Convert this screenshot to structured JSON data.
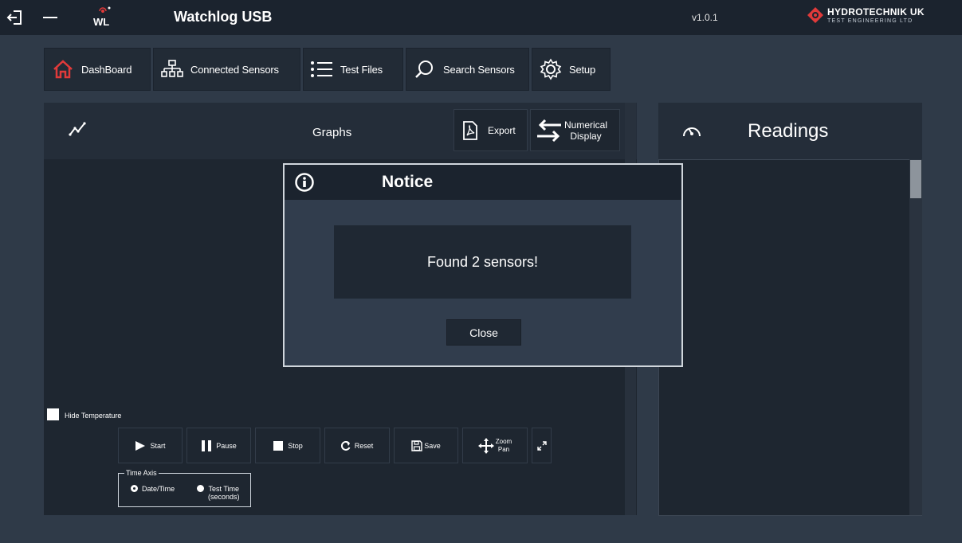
{
  "titlebar": {
    "title": "Watchlog USB",
    "logo_text": "WL",
    "version": "v1.0.1",
    "brand_name": "HYDROTECHNIK UK",
    "brand_sub": "TEST ENGINEERING LTD",
    "icons": [
      "exit-icon",
      "minimize-icon",
      "wl-logo"
    ]
  },
  "nav": {
    "items": [
      {
        "label": "DashBoard",
        "icon": "home-icon"
      },
      {
        "label": "Connected Sensors",
        "icon": "network-icon"
      },
      {
        "label": "Test Files",
        "icon": "list-icon"
      },
      {
        "label": "Search Sensors",
        "icon": "search-icon"
      },
      {
        "label": "Setup",
        "icon": "gear-icon"
      }
    ]
  },
  "graphs": {
    "title": "Graphs",
    "export_label": "Export",
    "numerical_display_label_1": "Numerical",
    "numerical_display_label_2": "Display",
    "hide_temperature_label": "Hide Temperature",
    "controls": {
      "start": "Start",
      "pause": "Pause",
      "stop": "Stop",
      "reset": "Reset",
      "save": "Save",
      "zoom": "Zoom",
      "pan": "Pan"
    },
    "time_axis": {
      "legend": "Time Axis",
      "option_datetime": "Date/Time",
      "option_testtime_1": "Test Time",
      "option_testtime_2": "(seconds)",
      "selected": "Date/Time"
    }
  },
  "readings": {
    "title": "Readings"
  },
  "dialog": {
    "title": "Notice",
    "message": "Found 2 sensors!",
    "close_label": "Close"
  },
  "colors": {
    "background": "#2f3a48",
    "titlebar": "#1b232e",
    "panel": "#1e2630",
    "accent_red": "#e03a3a"
  }
}
